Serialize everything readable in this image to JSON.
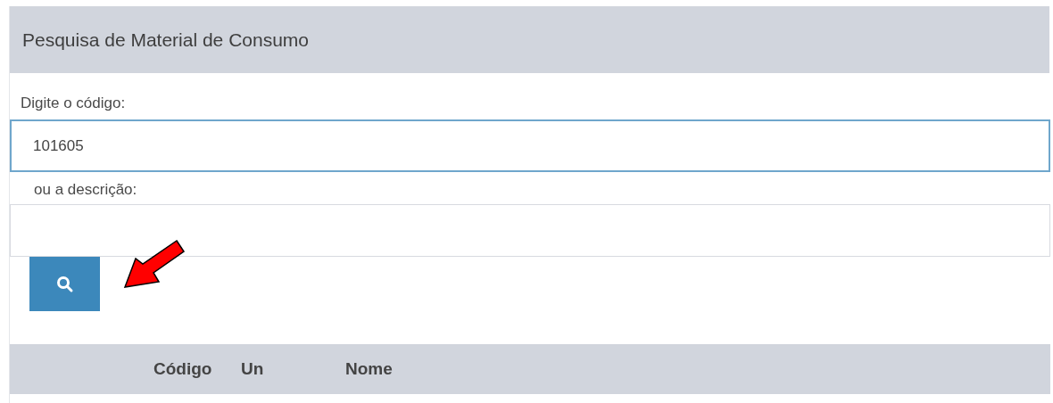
{
  "panel": {
    "title": "Pesquisa de Material de Consumo"
  },
  "fields": [
    {
      "label": "Digite o código:",
      "value": "101605",
      "focused": true
    },
    {
      "label": "ou a descrição:",
      "focused": false
    }
  ],
  "search_button": {
    "kind": "search"
  },
  "annotation": {
    "kind": "arrow"
  },
  "table": {
    "columns": [
      {
        "label": "Código"
      },
      {
        "label": "Un"
      },
      {
        "label": "Nome"
      }
    ]
  }
}
